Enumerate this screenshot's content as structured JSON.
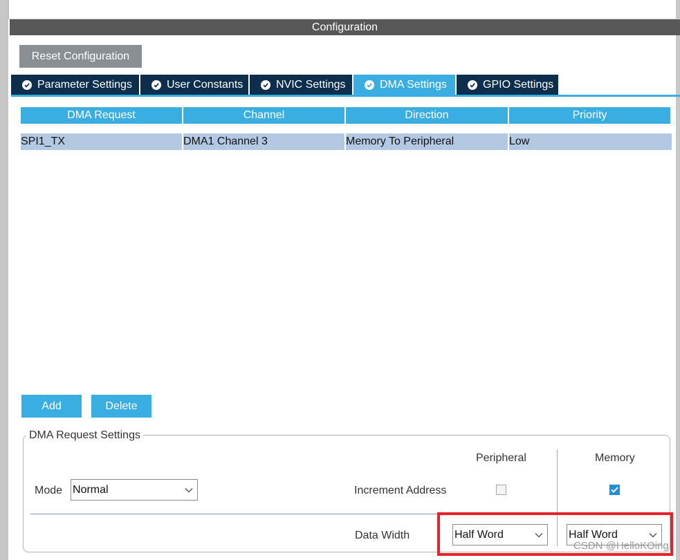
{
  "config_bar": {
    "title": "Configuration"
  },
  "reset_button": {
    "label": "Reset Configuration"
  },
  "tabs": [
    {
      "label": "Parameter Settings",
      "active": false
    },
    {
      "label": "User Constants",
      "active": false
    },
    {
      "label": "NVIC Settings",
      "active": false
    },
    {
      "label": "DMA Settings",
      "active": true
    },
    {
      "label": "GPIO Settings",
      "active": false
    }
  ],
  "dma_table": {
    "columns": [
      "DMA Request",
      "Channel",
      "Direction",
      "Priority"
    ],
    "rows": [
      {
        "request": "SPI1_TX",
        "channel": "DMA1 Channel 3",
        "direction": "Memory To Peripheral",
        "priority": "Low"
      }
    ]
  },
  "buttons": {
    "add": "Add",
    "delete": "Delete"
  },
  "request_settings": {
    "title": "DMA Request Settings",
    "peripheral_header": "Peripheral",
    "memory_header": "Memory",
    "mode_label": "Mode",
    "mode_value": "Normal",
    "increment_label": "Increment Address",
    "peripheral_increment": false,
    "memory_increment": true,
    "data_width_label": "Data Width",
    "peripheral_width": "Half Word",
    "memory_width": "Half Word"
  },
  "watermark": "CSDN @HelloKOing",
  "colors": {
    "accent": "#3aaee0",
    "tab_dark": "#0d2e4d",
    "config_bar": "#575757",
    "row_selected": "#b3c9e3",
    "highlight": "#e8222b"
  },
  "icons": {
    "tab_icon": "check-circle-icon",
    "dropdown": "chevron-down-icon",
    "checkbox_checked": "checkmark-icon"
  }
}
